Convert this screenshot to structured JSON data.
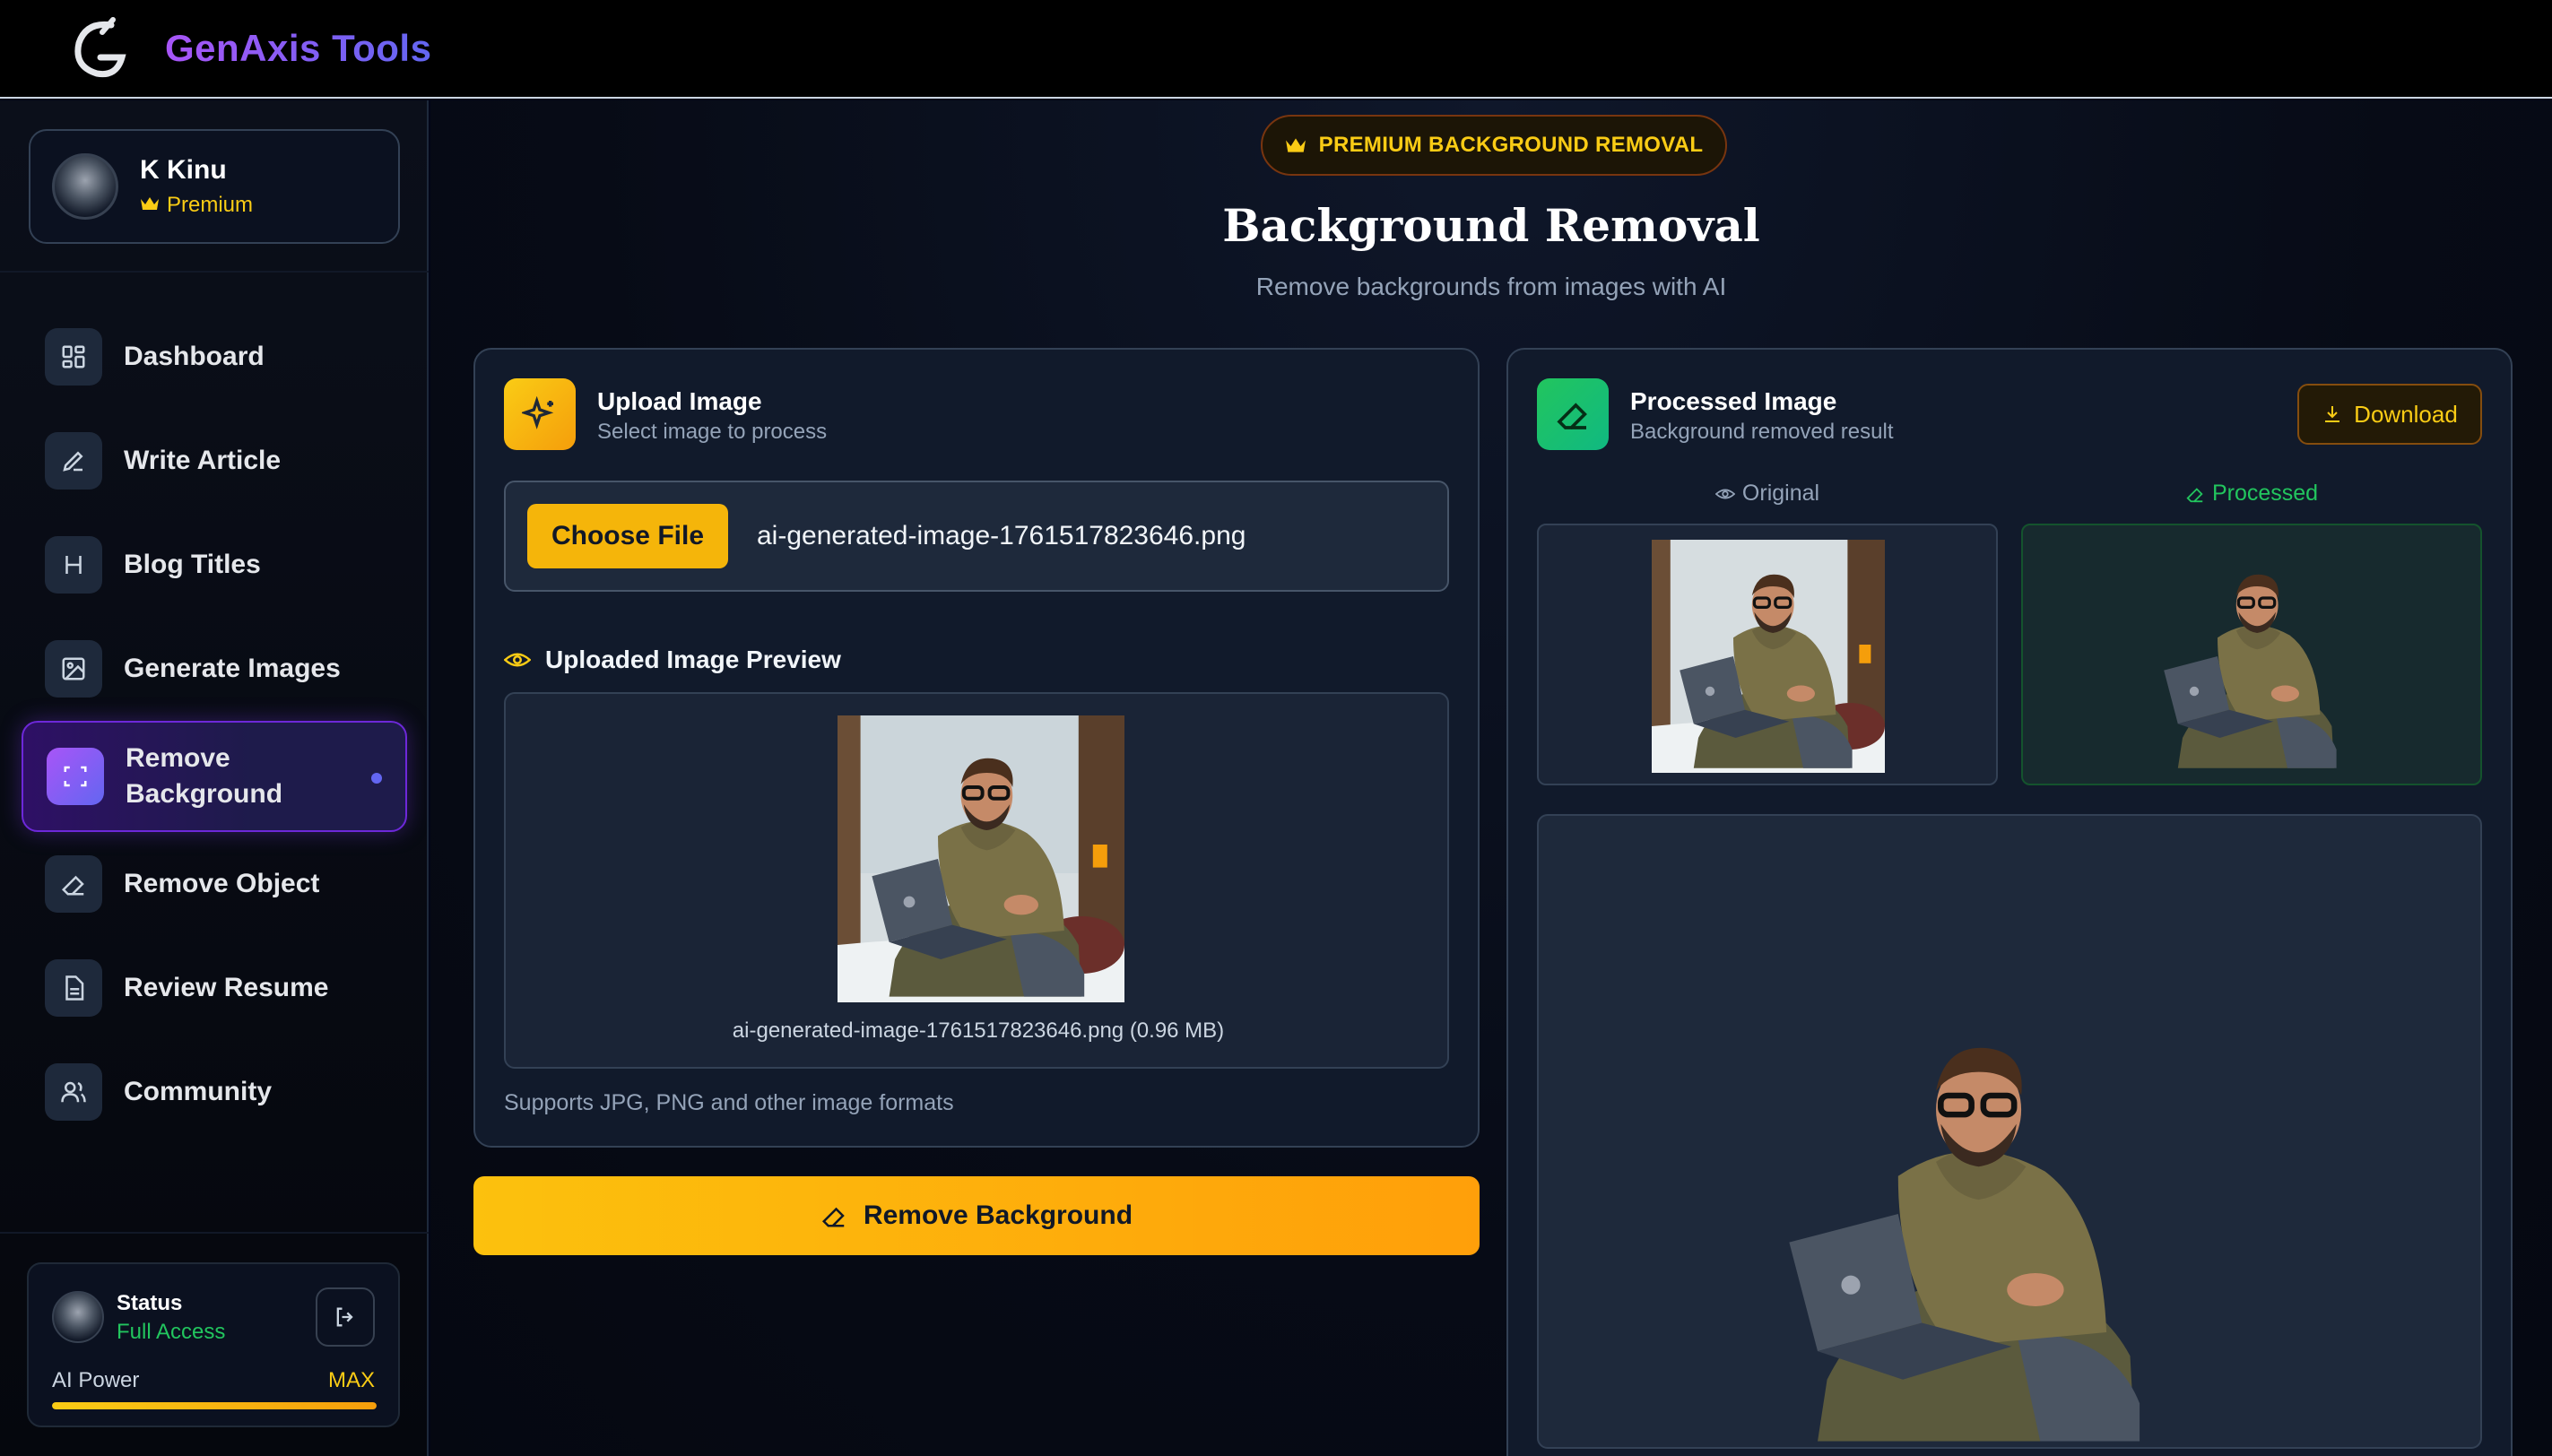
{
  "app": {
    "title": "GenAxis Tools",
    "logo_icon": "genaxis-g-logo"
  },
  "profile": {
    "name": "K Kinu",
    "plan": "Premium",
    "plan_icon": "crown-icon"
  },
  "sidebar": {
    "items": [
      {
        "label": "Dashboard",
        "icon": "dashboard-grid-icon"
      },
      {
        "label": "Write Article",
        "icon": "pen-icon"
      },
      {
        "label": "Blog Titles",
        "icon": "heading-icon"
      },
      {
        "label": "Generate Images",
        "icon": "image-icon"
      },
      {
        "label": "Remove Background",
        "icon": "scan-frame-icon",
        "active": true
      },
      {
        "label": "Remove Object",
        "icon": "eraser-icon"
      },
      {
        "label": "Review Resume",
        "icon": "document-icon"
      },
      {
        "label": "Community",
        "icon": "users-icon"
      }
    ]
  },
  "status": {
    "title": "Status",
    "value": "Full Access",
    "power_label": "AI Power",
    "power_value": "MAX",
    "power_level_percent": 100
  },
  "main": {
    "badge": "PREMIUM BACKGROUND REMOVAL",
    "title": "Background Removal",
    "subtitle": "Remove backgrounds from images with AI"
  },
  "upload": {
    "title": "Upload Image",
    "subtitle": "Select image to process",
    "choose_label": "Choose File",
    "file_name": "ai-generated-image-1761517823646.png",
    "preview_label": "Uploaded Image Preview",
    "preview_caption": "ai-generated-image-1761517823646.png (0.96 MB)",
    "supports": "Supports JPG, PNG and other image formats"
  },
  "action": {
    "remove_label": "Remove Background"
  },
  "processed": {
    "title": "Processed Image",
    "subtitle": "Background removed result",
    "download_label": "Download",
    "original_label": "Original",
    "processed_label": "Processed"
  },
  "colors": {
    "accent_gold": "#f5b50a",
    "accent_purple": "#a855f7",
    "accent_green": "#22c55e",
    "background": "#050811"
  }
}
